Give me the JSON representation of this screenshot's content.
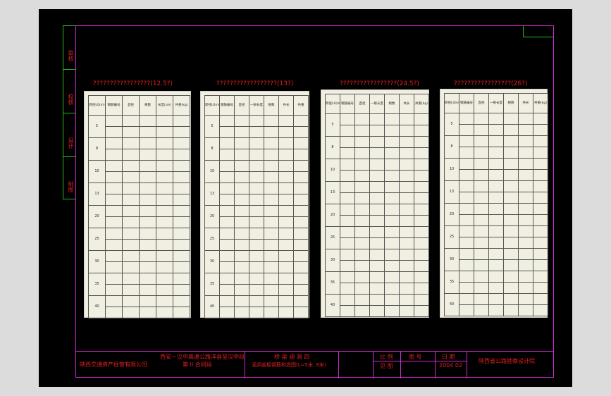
{
  "margin_strip": {
    "labels": [
      "审核",
      "校核",
      "设计",
      "制图"
    ]
  },
  "tables": [
    {
      "title": "?????????????????(12.5?)",
      "headers": [
        "跨径L0(m)",
        "钢筋编号",
        "直径",
        "根数",
        "长度(cm)",
        "共重(kg)"
      ],
      "groups": [
        "5",
        "8",
        "10",
        "13",
        "20",
        "25",
        "30",
        "35",
        "40"
      ]
    },
    {
      "title": "??????????????????(13?)",
      "headers": [
        "跨径L0(m)",
        "钢筋编号",
        "直径",
        "一根长度",
        "根数",
        "共长",
        "共重"
      ],
      "groups": [
        "5",
        "8",
        "10",
        "13",
        "20",
        "25",
        "30",
        "35",
        "40"
      ]
    },
    {
      "title": "?????????????????(24.5?)",
      "headers": [
        "跨径L0(m)",
        "钢筋编号",
        "直径",
        "一根长度",
        "根数",
        "共长",
        "共重(kg)"
      ],
      "groups": [
        "5",
        "8",
        "10",
        "13",
        "20",
        "25",
        "30",
        "35",
        "40"
      ]
    },
    {
      "title": "?????????????????(26?)",
      "headers": [
        "跨径L0(m)",
        "钢筋编号",
        "直径",
        "一根长度",
        "根数",
        "共长",
        "共重(kg)"
      ],
      "groups": [
        "5",
        "8",
        "10",
        "13",
        "20",
        "25",
        "30",
        "35",
        "40"
      ]
    }
  ],
  "title_block": {
    "company": "陕西交通资产经营有限公司",
    "project_line1": "西安－汉中高速公路洋县至汉中段",
    "project_line2": "第 II 合同段",
    "drawing_line1": "桥 梁 涵 洞 四",
    "drawing_line2": "涵洞盖板钢筋构造图(L=5米, 8米)",
    "scale_label": "比 例",
    "drawing_no_label": "图 号",
    "date_label": "日 期",
    "sheet_label": "见 图",
    "date_value": "2004.02",
    "designer": "陕西省公路勘察设计院"
  }
}
